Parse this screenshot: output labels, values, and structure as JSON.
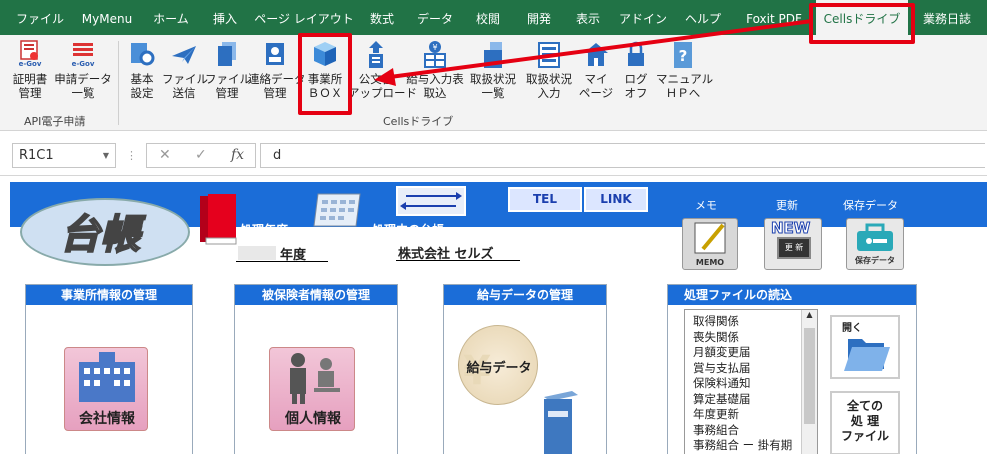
{
  "tabs": [
    "ファイル",
    "MyMenu",
    "ホーム",
    "挿入",
    "ページ レイアウト",
    "数式",
    "データ",
    "校閲",
    "開発",
    "表示",
    "アドイン",
    "ヘルプ",
    "Foxit PDF",
    "Cellsドライブ",
    "業務日誌"
  ],
  "active_tab": "Cellsドライブ",
  "ribbon": {
    "api_group_label": "API電子申請",
    "cells_group_label": "Cellsドライブ",
    "btn_shomei": [
      "証明書",
      "管理"
    ],
    "btn_shinsei": [
      "申請データ",
      "一覧"
    ],
    "btn_kihon": [
      "基本",
      "設定"
    ],
    "btn_file_send": [
      "ファイル",
      "送信"
    ],
    "btn_file_kanri": [
      "ファイル",
      "管理"
    ],
    "btn_renraku": [
      "連絡データ",
      "管理"
    ],
    "btn_jigyosho": [
      "事業所",
      "ＢＯＸ"
    ],
    "btn_kobunsho": [
      "公文書",
      "アップロード"
    ],
    "btn_kyuyo": [
      "給与入力表",
      "取込"
    ],
    "btn_toriatsukai_list": [
      "取扱状況",
      "一覧"
    ],
    "btn_toriatsukai_input": [
      "取扱状況",
      "入力"
    ],
    "btn_mypage": [
      "マイ",
      "ページ"
    ],
    "btn_logoff": [
      "ログ",
      "オフ"
    ],
    "btn_manual": [
      "マニュアル",
      "ＨＰへ"
    ],
    "egov_text": "e-Gov"
  },
  "formula_bar": {
    "name_box": "R1C1",
    "fx": "fx",
    "content": "d"
  },
  "sheet": {
    "logo": "台帳",
    "shori_nendo": "処理年度",
    "shorichu_daicho": "処理中の台帳",
    "nendo_suffix": "年度",
    "company": "株式会社 セルズ",
    "tel": "TEL",
    "link": "LINK",
    "memo_label": "メモ",
    "koshin_label": "更新",
    "hozon_label": "保存データ",
    "memo_icon": "MEMO",
    "new_icon": "NEW",
    "koshin_icon": "更 新",
    "hozon_icon": "保存データ",
    "panel1_title": "事業所情報の管理",
    "panel1_btn": "会社情報",
    "panel2_title": "被保険者情報の管理",
    "panel2_btn": "個人情報",
    "panel3_title": "給与データの管理",
    "panel3_btn": "給与データ",
    "panel4_title": "処理ファイルの読込",
    "list_items": [
      "取得関係",
      "喪失関係",
      "月額変更届",
      "賞与支払届",
      "保険料通知",
      "算定基礎届",
      "年度更新",
      "事務組合",
      "事務組合 ー 掛有期"
    ],
    "open_label": "開く",
    "all_files": [
      "全ての",
      "処 理",
      "ファイル"
    ]
  },
  "colors": {
    "ribbon_green": "#217346",
    "banner_blue": "#1b6dd8",
    "highlight_red": "#e50012"
  }
}
